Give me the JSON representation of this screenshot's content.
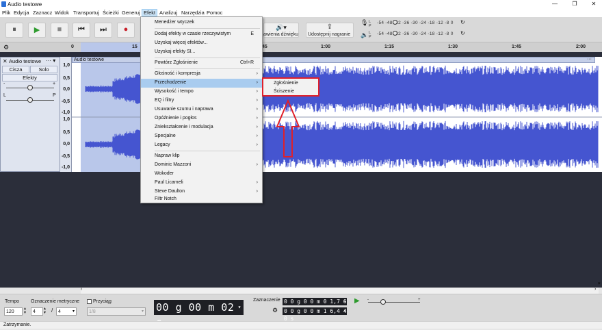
{
  "window": {
    "title": "Audio testowe",
    "minimize": "—",
    "maximize": "❐",
    "close": "✕"
  },
  "menubar": [
    "Plik",
    "Edycja",
    "Zaznacz",
    "Widok",
    "Transportuj",
    "Ścieżki",
    "Generuj",
    "Efekt",
    "Analizuj",
    "Narzędzia",
    "Pomoc"
  ],
  "toolbar": {
    "pause": "⏸",
    "play": "▶",
    "stop": "■",
    "skip_start": "⏮",
    "skip_end": "⏭",
    "record": "●",
    "audio_setup_label": "awienia dźwięku",
    "share_label": "Udostępnij nagranie",
    "meter_scale": "-54  -48  -42  -36  -30  -24  -18  -12  -8   0",
    "meter_lp": "L\nP"
  },
  "ruler": {
    "ticks": [
      "0",
      "15",
      "1:00",
      "1:15",
      "1:30",
      "1:45",
      "2:00"
    ],
    "tick_45": "45"
  },
  "track": {
    "name": "Audio testowe",
    "mute": "Cisza",
    "solo": "Solo",
    "effects": "Efekty",
    "left": "L",
    "right": "P",
    "clip_name": "Audio testowe",
    "scale_labels": [
      "1,0",
      "0,5",
      "0,0",
      "-0,5",
      "-1,0",
      "1,0",
      "0,5",
      "0,0",
      "-0,5",
      "-1,0"
    ]
  },
  "effect_menu": {
    "items": [
      {
        "label": "Menedżer wtyczek"
      },
      {
        "label": "Dodaj efekty w czasie rzeczywistym",
        "shortcut": "E"
      },
      {
        "label": "Uzyskaj więcej efektów..."
      },
      {
        "label": "Uzyskaj efekty SI..."
      },
      {
        "label": "Powtórz Zgłośnienie",
        "shortcut": "Ctrl+R"
      },
      {
        "label": "Głośność i kompresja",
        "arrow": "›"
      },
      {
        "label": "Przechodzenie",
        "arrow": "›"
      },
      {
        "label": "Wysokość i tempo",
        "arrow": "›"
      },
      {
        "label": "EQ i filtry",
        "arrow": "›"
      },
      {
        "label": "Usuwanie szumu i naprawa",
        "arrow": "›"
      },
      {
        "label": "Opóźnienie i pogłos",
        "arrow": "›"
      },
      {
        "label": "Zniekształcenie i modulacja",
        "arrow": "›"
      },
      {
        "label": "Specjalne",
        "arrow": "›"
      },
      {
        "label": "Legacy",
        "arrow": "›"
      },
      {
        "label": "Napraw klip"
      },
      {
        "label": "Dominic Mazzoni",
        "arrow": "›"
      },
      {
        "label": "Wokoder"
      },
      {
        "label": "Paul Licameli",
        "arrow": "›"
      },
      {
        "label": "Steve Daulton",
        "arrow": "›"
      },
      {
        "label": "Filtr Notch"
      }
    ],
    "submenu": [
      "Zgłośnienie",
      "Ściszenie"
    ]
  },
  "bottom": {
    "tempo_label": "Tempo",
    "tempo_value": "120",
    "meter_label": "Oznaczenie metryczne",
    "meter_num": "4",
    "meter_slash": "/",
    "meter_den": "4",
    "snap_label": "Przyciąg",
    "snap_value": "1/8",
    "time": "00 g 00 m 02 s",
    "selection_label": "Zaznaczenie",
    "sel_start": "0 0 g 0 0 m 0 1,7 6 5 s",
    "sel_end": "0 0 g 0 0 m 1 6,4 4 0 s"
  },
  "status": "Zatrzymanie.",
  "colors": {
    "accent": "#3a6fd8",
    "highlight": "#e0202a",
    "waveform": "#4555d0"
  }
}
